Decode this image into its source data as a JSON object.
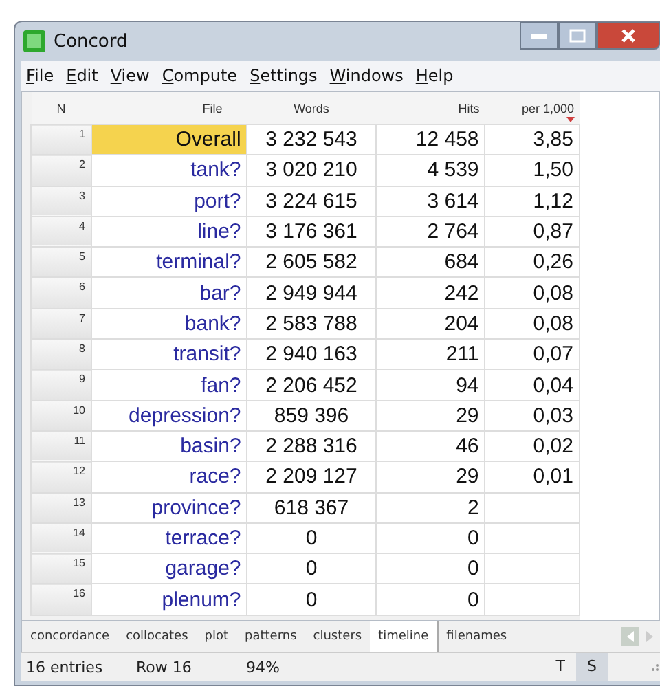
{
  "window": {
    "title": "Concord"
  },
  "menu": [
    "File",
    "Edit",
    "View",
    "Compute",
    "Settings",
    "Windows",
    "Help"
  ],
  "table": {
    "columns": [
      {
        "label": "N",
        "sorted": false
      },
      {
        "label": "File",
        "sorted": false
      },
      {
        "label": "Words",
        "sorted": false
      },
      {
        "label": "Hits",
        "sorted": false
      },
      {
        "label": "per 1,000",
        "sorted": true
      }
    ],
    "rows": [
      {
        "n": "1",
        "file": "Overall",
        "words": "3 232 543",
        "hits": "12 458",
        "per": "3,85",
        "selected": true
      },
      {
        "n": "2",
        "file": "tank?",
        "words": "3 020 210",
        "hits": "4 539",
        "per": "1,50",
        "selected": false
      },
      {
        "n": "3",
        "file": "port?",
        "words": "3 224 615",
        "hits": "3 614",
        "per": "1,12",
        "selected": false
      },
      {
        "n": "4",
        "file": "line?",
        "words": "3 176 361",
        "hits": "2 764",
        "per": "0,87",
        "selected": false
      },
      {
        "n": "5",
        "file": "terminal?",
        "words": "2 605 582",
        "hits": "684",
        "per": "0,26",
        "selected": false
      },
      {
        "n": "6",
        "file": "bar?",
        "words": "2 949 944",
        "hits": "242",
        "per": "0,08",
        "selected": false
      },
      {
        "n": "7",
        "file": "bank?",
        "words": "2 583 788",
        "hits": "204",
        "per": "0,08",
        "selected": false
      },
      {
        "n": "8",
        "file": "transit?",
        "words": "2 940 163",
        "hits": "211",
        "per": "0,07",
        "selected": false
      },
      {
        "n": "9",
        "file": "fan?",
        "words": "2 206 452",
        "hits": "94",
        "per": "0,04",
        "selected": false
      },
      {
        "n": "10",
        "file": "depression?",
        "words": "859 396",
        "hits": "29",
        "per": "0,03",
        "selected": false
      },
      {
        "n": "11",
        "file": "basin?",
        "words": "2 288 316",
        "hits": "46",
        "per": "0,02",
        "selected": false
      },
      {
        "n": "12",
        "file": "race?",
        "words": "2 209 127",
        "hits": "29",
        "per": "0,01",
        "selected": false
      },
      {
        "n": "13",
        "file": "province?",
        "words": "618 367",
        "hits": "2",
        "selected": false
      },
      {
        "n": "14",
        "file": "terrace?",
        "words": "0",
        "hits": "0",
        "selected": false
      },
      {
        "n": "15",
        "file": "garage?",
        "words": "0",
        "hits": "0",
        "selected": false
      },
      {
        "n": "16",
        "file": "plenum?",
        "words": "0",
        "hits": "0",
        "selected": false
      }
    ]
  },
  "tabs": [
    {
      "label": "concordance",
      "selected": false
    },
    {
      "label": "collocates",
      "selected": false
    },
    {
      "label": "plot",
      "selected": false
    },
    {
      "label": "patterns",
      "selected": false
    },
    {
      "label": "clusters",
      "selected": false
    },
    {
      "label": "timeline",
      "selected": true
    },
    {
      "label": "filenames",
      "selected": false
    }
  ],
  "status_bar": {
    "entries": "16 entries",
    "row": "Row 16",
    "percent": "94%",
    "toggles": [
      {
        "label": "T",
        "on": false
      },
      {
        "label": "S",
        "on": true
      }
    ]
  }
}
